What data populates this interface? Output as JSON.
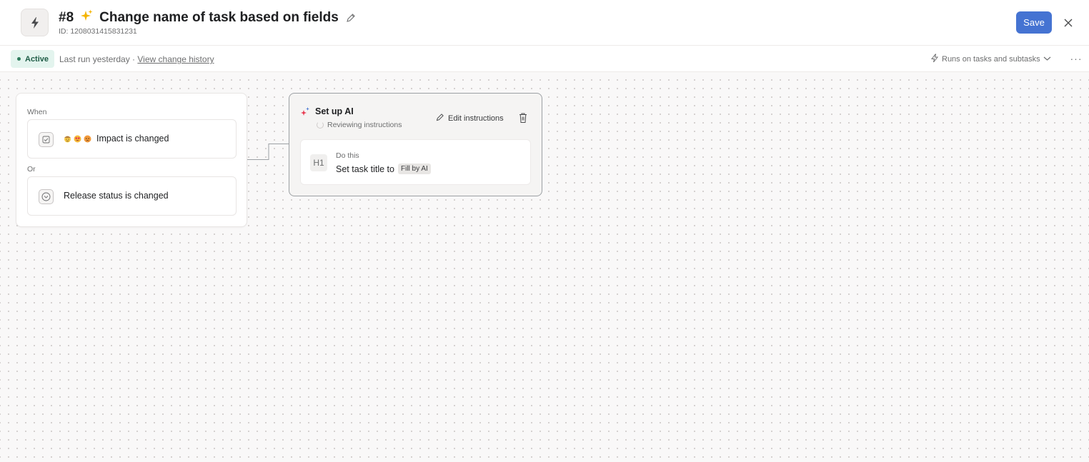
{
  "header": {
    "rule_number": "#8",
    "title_icon": "sparkles-emoji",
    "title": "Change name of task based on fields",
    "id_label": "ID: 1208031415831231",
    "save_label": "Save"
  },
  "statusbar": {
    "status": "Active",
    "last_run": "Last run yesterday · ",
    "history_link": "View change history",
    "runs_on": "Runs on tasks and subtasks",
    "more": "···"
  },
  "trigger": {
    "when_label": "When",
    "or_label": "Or",
    "items": [
      {
        "icon": "checkbox-icon",
        "label": "Impact is changed",
        "emojis": [
          "cowboy-face",
          "heart-eyes-face",
          "pouting-face"
        ]
      },
      {
        "icon": "chevron-circle-icon",
        "label": "Release status is changed"
      }
    ]
  },
  "ai_step": {
    "title": "Set up AI",
    "subtitle": "Reviewing instructions",
    "edit_label": "Edit instructions",
    "action": {
      "icon": "H1",
      "label": "Do this",
      "text": "Set task title to",
      "chip": "Fill by AI"
    }
  },
  "colors": {
    "accent": "#4573d2",
    "active_bg": "#e3f4ee",
    "active_text": "#1e5c46"
  }
}
